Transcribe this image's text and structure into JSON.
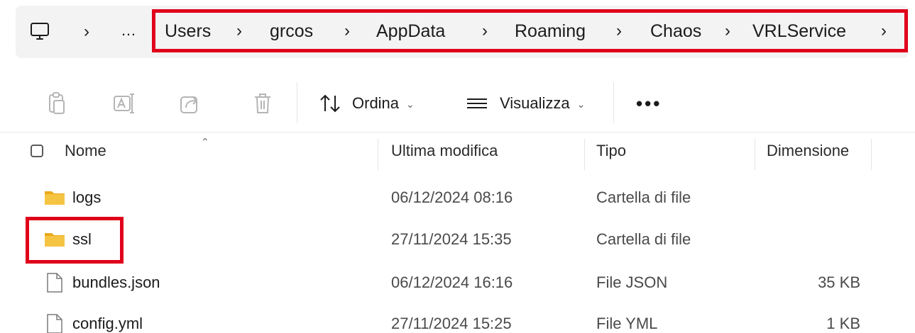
{
  "address_bar": {
    "ellipsis": "…",
    "first_separator": "›",
    "breadcrumbs": [
      "Users",
      "grcos",
      "AppData",
      "Roaming",
      "Chaos",
      "VRLService"
    ],
    "separator": "›"
  },
  "toolbar": {
    "sort_label": "Ordina",
    "view_label": "Visualizza",
    "more_label": "•••"
  },
  "columns": {
    "name": "Nome",
    "modified": "Ultima modifica",
    "type": "Tipo",
    "size": "Dimensione"
  },
  "files": [
    {
      "name": "logs",
      "modified": "06/12/2024 08:16",
      "type": "Cartella di file",
      "size": "",
      "icon": "folder-icon"
    },
    {
      "name": "ssl",
      "modified": "27/11/2024 15:35",
      "type": "Cartella di file",
      "size": "",
      "icon": "folder-icon"
    },
    {
      "name": "bundles.json",
      "modified": "06/12/2024 16:16",
      "type": "File JSON",
      "size": "35 KB",
      "icon": "file-icon"
    },
    {
      "name": "config.yml",
      "modified": "27/11/2024 15:25",
      "type": "File YML",
      "size": "1 KB",
      "icon": "file-icon"
    }
  ],
  "colors": {
    "highlight_red": "#e0001a",
    "folder_yellow": "#f6c443",
    "address_bg": "#f3f3f3"
  }
}
